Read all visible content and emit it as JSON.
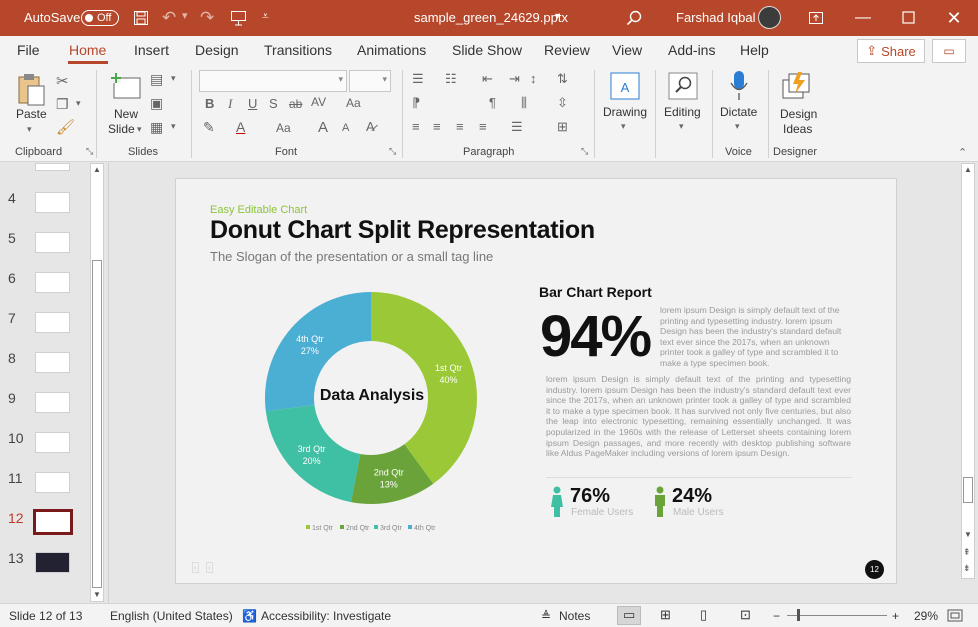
{
  "titlebar": {
    "autosave_label": "AutoSave",
    "autosave_state": "Off",
    "filename": "sample_green_24629.pptx",
    "user_name": "Farshad Iqbal"
  },
  "tabs": [
    "File",
    "Home",
    "Insert",
    "Design",
    "Transitions",
    "Animations",
    "Slide Show",
    "Review",
    "View",
    "Add-ins",
    "Help"
  ],
  "share_label": "Share",
  "ribbon": {
    "paste_label": "Paste",
    "new_slide_label": "New",
    "new_slide_label2": "Slide",
    "drawing_label": "Drawing",
    "editing_label": "Editing",
    "dictate_label": "Dictate",
    "design_ideas_label": "Design",
    "design_ideas_label2": "Ideas",
    "groups": [
      "Clipboard",
      "Slides",
      "Font",
      "Paragraph",
      "Voice",
      "Designer"
    ]
  },
  "slide_numbers": [
    "4",
    "5",
    "6",
    "7",
    "8",
    "9",
    "10",
    "11",
    "12",
    "13"
  ],
  "selected_slide": "12",
  "slide": {
    "kicker": "Easy Editable Chart",
    "title": "Donut Chart Split Representation",
    "subtitle": "The Slogan of the presentation or a small tag line",
    "donut_center": "Data Analysis",
    "bar_report_title": "Bar Chart Report",
    "big_percent": "94%",
    "lorem_short": "lorem ipsum Design is simply default text of the printing and typesetting industry. lorem ipsum Design has been the industry's standard default text ever since the 2017s, when an unknown printer took a galley of type and scrambled it to make a type specimen book.",
    "lorem_long": "lorem ipsum Design is simply default text of the printing and typesetting industry. lorem ipsum Design has been the industry's standard default text ever since the 2017s, when an unknown printer took a galley of type and scrambled it to make a type specimen book. It has survived not only five centuries, but also the leap into electronic typesetting, remaining essentially unchanged. It was popularized in the 1960s with the release of Letterset sheets containing lorem ipsum Design passages, and more recently with desktop publishing software like Aldus PageMaker including versions of lorem ipsum Design.",
    "female_pct": "76%",
    "female_label": "Female Users",
    "male_pct": "24%",
    "male_label": "Male Users",
    "page_number": "12"
  },
  "chart_data": {
    "type": "pie",
    "categories": [
      "1st Qtr",
      "2nd Qtr",
      "3rd Qtr",
      "4th Qtr"
    ],
    "values": [
      40,
      13,
      20,
      27
    ],
    "value_labels": [
      "40%",
      "13%",
      "20%",
      "27%"
    ],
    "colors": [
      "#9bc837",
      "#6aa33a",
      "#3fbfa3",
      "#4baed3"
    ],
    "legend": [
      "1st Qtr",
      "2nd Qtr",
      "3rd Qtr",
      "4th Qtr"
    ],
    "legend_position": "bottom",
    "donut": true
  },
  "statusbar": {
    "slide_info": "Slide 12 of 13",
    "language": "English (United States)",
    "accessibility": "Accessibility: Investigate",
    "notes": "Notes",
    "zoom": "29%"
  }
}
